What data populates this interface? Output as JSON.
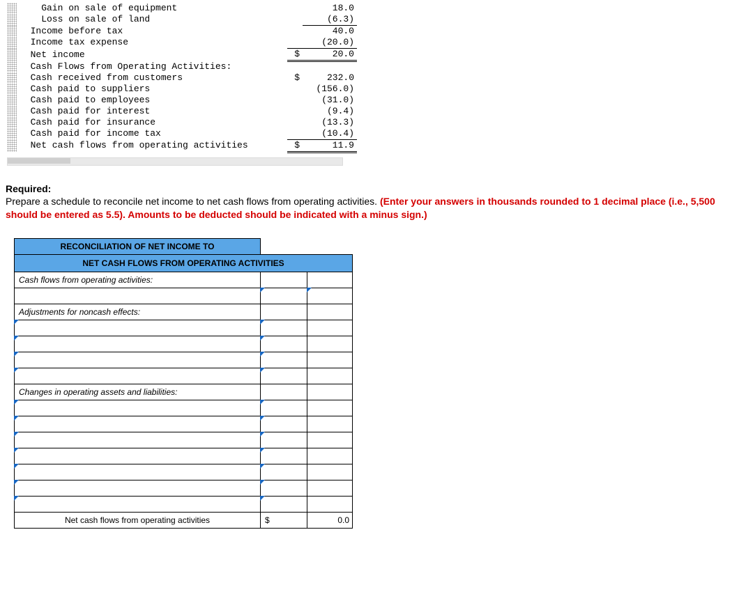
{
  "statement": {
    "rows": [
      {
        "indent": 2,
        "label": "Gain on sale of equipment",
        "sym": "",
        "val": "18.0",
        "cls": ""
      },
      {
        "indent": 2,
        "label": "Loss on sale of land",
        "sym": "",
        "val": "(6.3)",
        "cls": "subline"
      },
      {
        "indent": 1,
        "label": "Income before tax",
        "sym": "",
        "val": "40.0",
        "cls": ""
      },
      {
        "indent": 1,
        "label": "Income tax expense",
        "sym": "",
        "val": "(20.0)",
        "cls": "subline"
      },
      {
        "indent": 1,
        "label": "Net income",
        "sym": "$",
        "val": "20.0",
        "cls": "totline"
      },
      {
        "indent": 1,
        "label": "Cash Flows from Operating Activities:",
        "sym": "",
        "val": "",
        "cls": ""
      },
      {
        "indent": 1,
        "label": "Cash received from customers",
        "sym": "$",
        "val": "232.0",
        "cls": ""
      },
      {
        "indent": 1,
        "label": "Cash paid to suppliers",
        "sym": "",
        "val": "(156.0)",
        "cls": ""
      },
      {
        "indent": 1,
        "label": "Cash paid to employees",
        "sym": "",
        "val": "(31.0)",
        "cls": ""
      },
      {
        "indent": 1,
        "label": "Cash paid for interest",
        "sym": "",
        "val": "(9.4)",
        "cls": ""
      },
      {
        "indent": 1,
        "label": "Cash paid for insurance",
        "sym": "",
        "val": "(13.3)",
        "cls": ""
      },
      {
        "indent": 1,
        "label": "Cash paid for income tax",
        "sym": "",
        "val": "(10.4)",
        "cls": "subline"
      },
      {
        "indent": 1,
        "label": "Net cash flows from operating activities",
        "sym": "$",
        "val": "11.9",
        "cls": "totline"
      }
    ]
  },
  "required": {
    "heading": "Required:",
    "text": "Prepare a schedule to reconcile net income to net cash flows from operating activities. ",
    "red": "(Enter your answers in thousands rounded to 1 decimal place (i.e., 5,500 should be entered as 5.5). Amounts to be deducted should be indicated with a minus sign.)"
  },
  "worksheet": {
    "title1": "RECONCILIATION OF NET INCOME TO",
    "title2": "NET CASH FLOWS FROM OPERATING ACTIVITIES",
    "section1": "Cash flows from operating activities:",
    "section2": "Adjustments for noncash effects:",
    "section3": "Changes in operating assets and liabilities:",
    "total_label": "Net cash flows from operating activities",
    "total_sym": "$",
    "total_val": "0.0"
  }
}
